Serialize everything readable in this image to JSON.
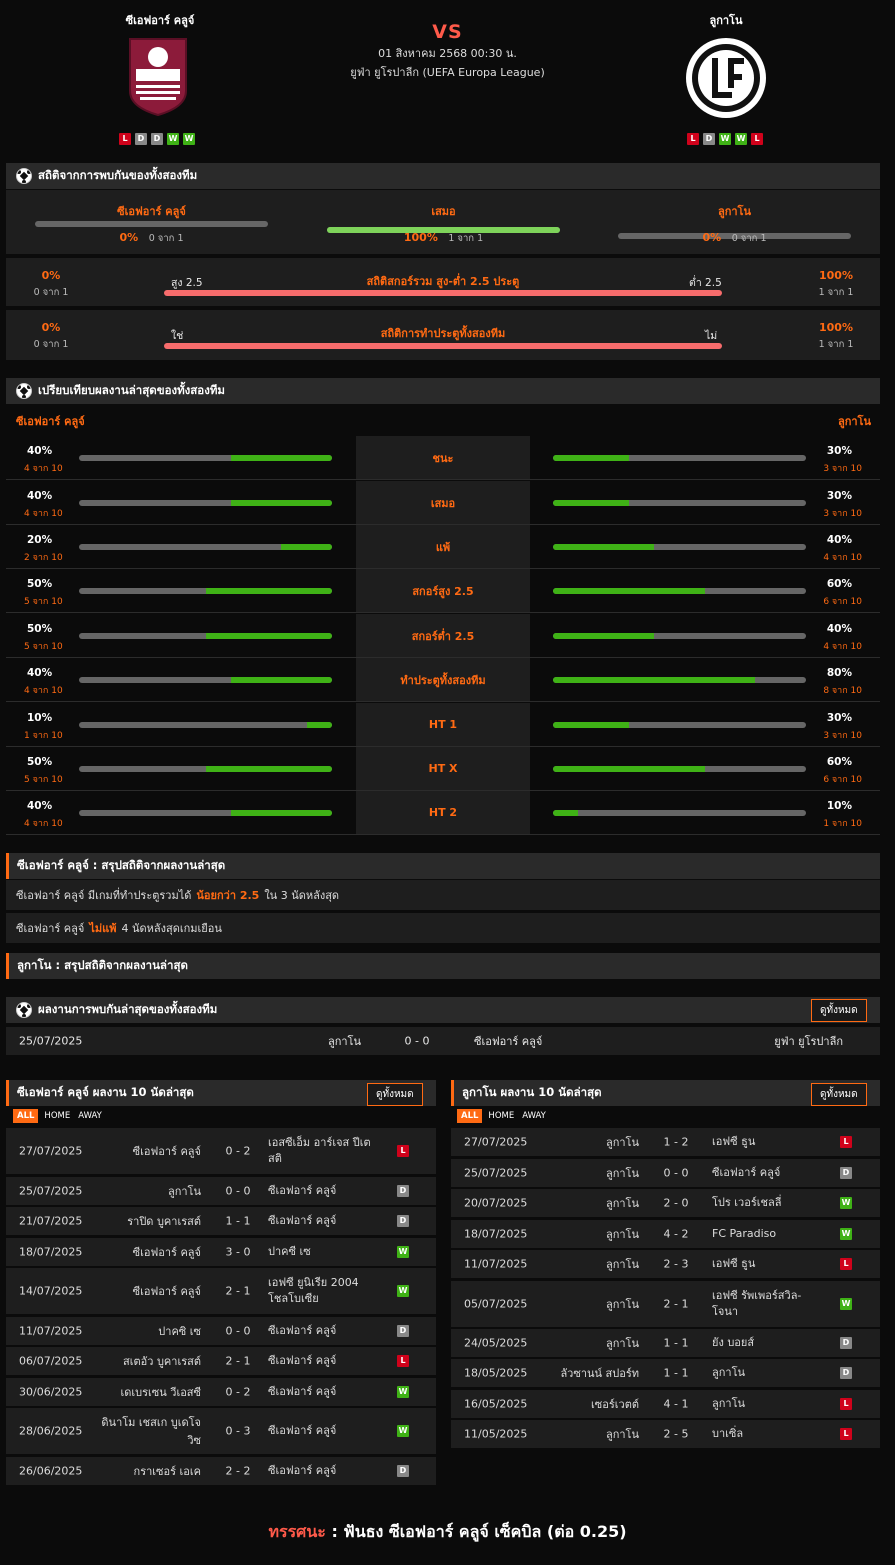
{
  "header": {
    "home_name": "ซีเอฟอาร์ คลูจ์",
    "away_name": "ลูกาโน",
    "vs": "VS",
    "datetime": "01 สิงหาคม 2568 00:30 น.",
    "competition": "ยูฟ่า ยูโรปาลีก (UEFA Europa League)",
    "home_form": [
      "L",
      "D",
      "D",
      "W",
      "W"
    ],
    "away_form": [
      "L",
      "D",
      "W",
      "W",
      "L"
    ],
    "home_crest_text": "CFR 1907",
    "away_crest_text": "FCL"
  },
  "h2h_stats": {
    "title": "สถิติจากการพบกันของทั้งสองทีม",
    "cols": [
      {
        "label": "ซีเอฟอาร์ คลูจ์",
        "pct": "0%",
        "sub": "0 จาก 1",
        "value": 0
      },
      {
        "label": "เสมอ",
        "pct": "100%",
        "sub": "1 จาก 1",
        "value": 100
      },
      {
        "label": "ลูกาโน",
        "pct": "0%",
        "sub": "0 จาก 1",
        "value": 0
      }
    ],
    "ou": {
      "title": "สถิติสกอร์รวม สูง-ต่ำ 2.5 ประตู",
      "left_label": "สูง 2.5",
      "right_label": "ต่ำ 2.5",
      "left_pct": "0%",
      "left_sub": "0 จาก 1",
      "right_pct": "100%",
      "right_sub": "1 จาก 1",
      "value": 100
    },
    "btts": {
      "title": "สถิติการทำประตูทั้งสองทีม",
      "left_label": "ใช่",
      "right_label": "ไม่",
      "left_pct": "0%",
      "left_sub": "0 จาก 1",
      "right_pct": "100%",
      "right_sub": "1 จาก 1",
      "value": 100
    }
  },
  "compare": {
    "title": "เปรียบเทียบผลงานล่าสุดของทั้งสองทีม",
    "home_name": "ซีเอฟอาร์ คลูจ์",
    "away_name": "ลูกาโน",
    "rows": [
      {
        "label": "ชนะ",
        "home_pct": "40%",
        "home_sub": "4 จาก 10",
        "home_val": 40,
        "away_pct": "30%",
        "away_sub": "3 จาก 10",
        "away_val": 30
      },
      {
        "label": "เสมอ",
        "home_pct": "40%",
        "home_sub": "4 จาก 10",
        "home_val": 40,
        "away_pct": "30%",
        "away_sub": "3 จาก 10",
        "away_val": 30
      },
      {
        "label": "แพ้",
        "home_pct": "20%",
        "home_sub": "2 จาก 10",
        "home_val": 20,
        "away_pct": "40%",
        "away_sub": "4 จาก 10",
        "away_val": 40
      },
      {
        "label": "สกอร์สูง 2.5",
        "home_pct": "50%",
        "home_sub": "5 จาก 10",
        "home_val": 50,
        "away_pct": "60%",
        "away_sub": "6 จาก 10",
        "away_val": 60
      },
      {
        "label": "สกอร์ต่ำ 2.5",
        "home_pct": "50%",
        "home_sub": "5 จาก 10",
        "home_val": 50,
        "away_pct": "40%",
        "away_sub": "4 จาก 10",
        "away_val": 40
      },
      {
        "label": "ทำประตูทั้งสองทีม",
        "home_pct": "40%",
        "home_sub": "4 จาก 10",
        "home_val": 40,
        "away_pct": "80%",
        "away_sub": "8 จาก 10",
        "away_val": 80
      },
      {
        "label": "HT 1",
        "home_pct": "10%",
        "home_sub": "1 จาก 10",
        "home_val": 10,
        "away_pct": "30%",
        "away_sub": "3 จาก 10",
        "away_val": 30
      },
      {
        "label": "HT X",
        "home_pct": "50%",
        "home_sub": "5 จาก 10",
        "home_val": 50,
        "away_pct": "60%",
        "away_sub": "6 จาก 10",
        "away_val": 60
      },
      {
        "label": "HT 2",
        "home_pct": "40%",
        "home_sub": "4 จาก 10",
        "home_val": 40,
        "away_pct": "10%",
        "away_sub": "1 จาก 10",
        "away_val": 10
      }
    ]
  },
  "summary": {
    "home_title": "ซีเอฟอาร์ คลูจ์ : สรุปสถิติจากผลงานล่าสุด",
    "line1_a": "ซีเอฟอาร์ คลูจ์ มีเกมที่ทำประตูรวมได้",
    "line1_b": "น้อยกว่า 2.5",
    "line1_c": "ใน 3 นัดหลังสุด",
    "line2_a": "ซีเอฟอาร์ คลูจ์",
    "line2_b": "ไม่แพ้",
    "line2_c": "4 นัดหลังสุดเกมเยือน",
    "away_title": "ลูกาโน : สรุปสถิติจากผลงานล่าสุด"
  },
  "recent_h2h": {
    "title": "ผลงานการพบกันล่าสุดของทั้งสองทีม",
    "view_all": "ดูทั้งหมด",
    "rows": [
      {
        "date": "25/07/2025",
        "home": "ลูกาโน",
        "score": "0 - 0",
        "away": "ซีเอฟอาร์ คลูจ์",
        "comp": "ยูฟ่า ยูโรปาลีก"
      }
    ]
  },
  "home_last10": {
    "title": "ซีเอฟอาร์ คลูจ์ ผลงาน 10 นัดล่าสุด",
    "view_all": "ดูทั้งหมด",
    "tabs": [
      "ALL",
      "HOME",
      "AWAY"
    ],
    "rows": [
      {
        "date": "27/07/2025",
        "home": "ซีเอฟอาร์ คลูจ์",
        "score": "0 - 2",
        "away": "เอสซีเอ็ม อาร์เจส ปีเตสติ",
        "res": "L"
      },
      {
        "date": "25/07/2025",
        "home": "ลูกาโน",
        "score": "0 - 0",
        "away": "ซีเอฟอาร์ คลูจ์",
        "res": "D"
      },
      {
        "date": "21/07/2025",
        "home": "ราปิด บูคาเรสต์",
        "score": "1 - 1",
        "away": "ซีเอฟอาร์ คลูจ์",
        "res": "D"
      },
      {
        "date": "18/07/2025",
        "home": "ซีเอฟอาร์ คลูจ์",
        "score": "3 - 0",
        "away": "ปาคซี เซ",
        "res": "W"
      },
      {
        "date": "14/07/2025",
        "home": "ซีเอฟอาร์ คลูจ์",
        "score": "2 - 1",
        "away": "เอฟซี ยูนิเรีย 2004 โชลโบเซีย",
        "res": "W"
      },
      {
        "date": "11/07/2025",
        "home": "ปาคซิ เซ",
        "score": "0 - 0",
        "away": "ซีเอฟอาร์ คลูจ์",
        "res": "D"
      },
      {
        "date": "06/07/2025",
        "home": "สเตอัว บูคาเรสต์",
        "score": "2 - 1",
        "away": "ซีเอฟอาร์ คลูจ์",
        "res": "L"
      },
      {
        "date": "30/06/2025",
        "home": "เดเบรเซน วีเอสซี",
        "score": "0 - 2",
        "away": "ซีเอฟอาร์ คลูจ์",
        "res": "W"
      },
      {
        "date": "28/06/2025",
        "home": "ดินาโม เชสเก บูเดโจวิซ",
        "score": "0 - 3",
        "away": "ซีเอฟอาร์ คลูจ์",
        "res": "W"
      },
      {
        "date": "26/06/2025",
        "home": "กราเซอร์ เอเค",
        "score": "2 - 2",
        "away": "ซีเอฟอาร์ คลูจ์",
        "res": "D"
      }
    ]
  },
  "away_last10": {
    "title": "ลูกาโน ผลงาน 10 นัดล่าสุด",
    "view_all": "ดูทั้งหมด",
    "tabs": [
      "ALL",
      "HOME",
      "AWAY"
    ],
    "rows": [
      {
        "date": "27/07/2025",
        "home": "ลูกาโน",
        "score": "1 - 2",
        "away": "เอฟซี ธูน",
        "res": "L"
      },
      {
        "date": "25/07/2025",
        "home": "ลูกาโน",
        "score": "0 - 0",
        "away": "ซีเอฟอาร์ คลูจ์",
        "res": "D"
      },
      {
        "date": "20/07/2025",
        "home": "ลูกาโน",
        "score": "2 - 0",
        "away": "โปร เวอร์เชลลี่",
        "res": "W"
      },
      {
        "date": "18/07/2025",
        "home": "ลูกาโน",
        "score": "4 - 2",
        "away": "FC Paradiso",
        "res": "W"
      },
      {
        "date": "11/07/2025",
        "home": "ลูกาโน",
        "score": "2 - 3",
        "away": "เอฟซี ธูน",
        "res": "L"
      },
      {
        "date": "05/07/2025",
        "home": "ลูกาโน",
        "score": "2 - 1",
        "away": "เอฟซี รัพเพอร์สวิล-โจนา",
        "res": "W"
      },
      {
        "date": "24/05/2025",
        "home": "ลูกาโน",
        "score": "1 - 1",
        "away": "ยัง บอยส์",
        "res": "D"
      },
      {
        "date": "18/05/2025",
        "home": "ลัวซานน์ สปอร์ท",
        "score": "1 - 1",
        "away": "ลูกาโน",
        "res": "D"
      },
      {
        "date": "16/05/2025",
        "home": "เซอร์เวตต์",
        "score": "4 - 1",
        "away": "ลูกาโน",
        "res": "L"
      },
      {
        "date": "11/05/2025",
        "home": "ลูกาโน",
        "score": "2 - 5",
        "away": "บาเซิ่ล",
        "res": "L"
      }
    ]
  },
  "footer": {
    "label": "ทรรศนะ",
    "sep": ":",
    "text": "ฟันธง ซีเอฟอาร์ คลูจ์ เซ็คบิล (ต่อ 0.25)"
  },
  "colors": {
    "accent": "#ff6a13",
    "green": "#3fb216",
    "red_bar": "#f76c6c",
    "light_green": "#7ed35a"
  }
}
